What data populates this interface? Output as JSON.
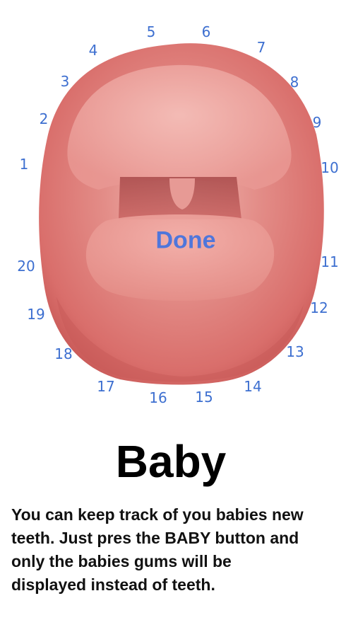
{
  "teeth": [
    {
      "n": "1"
    },
    {
      "n": "2"
    },
    {
      "n": "3"
    },
    {
      "n": "4"
    },
    {
      "n": "5"
    },
    {
      "n": "6"
    },
    {
      "n": "7"
    },
    {
      "n": "8"
    },
    {
      "n": "9"
    },
    {
      "n": "10"
    },
    {
      "n": "11"
    },
    {
      "n": "12"
    },
    {
      "n": "13"
    },
    {
      "n": "14"
    },
    {
      "n": "15"
    },
    {
      "n": "16"
    },
    {
      "n": "17"
    },
    {
      "n": "18"
    },
    {
      "n": "19"
    },
    {
      "n": "20"
    }
  ],
  "done_label": "Done",
  "title": "Baby",
  "description": "You can keep track of you babies new\nteeth. Just pres the BABY button and\nonly the babies gums will be\ndisplayed  instead of teeth.",
  "colors": {
    "gum": "#d9716f",
    "gum_light": "#f2a8a2",
    "throat": "#b95454",
    "number": "#3d6fd0",
    "done": "#4272e0"
  }
}
